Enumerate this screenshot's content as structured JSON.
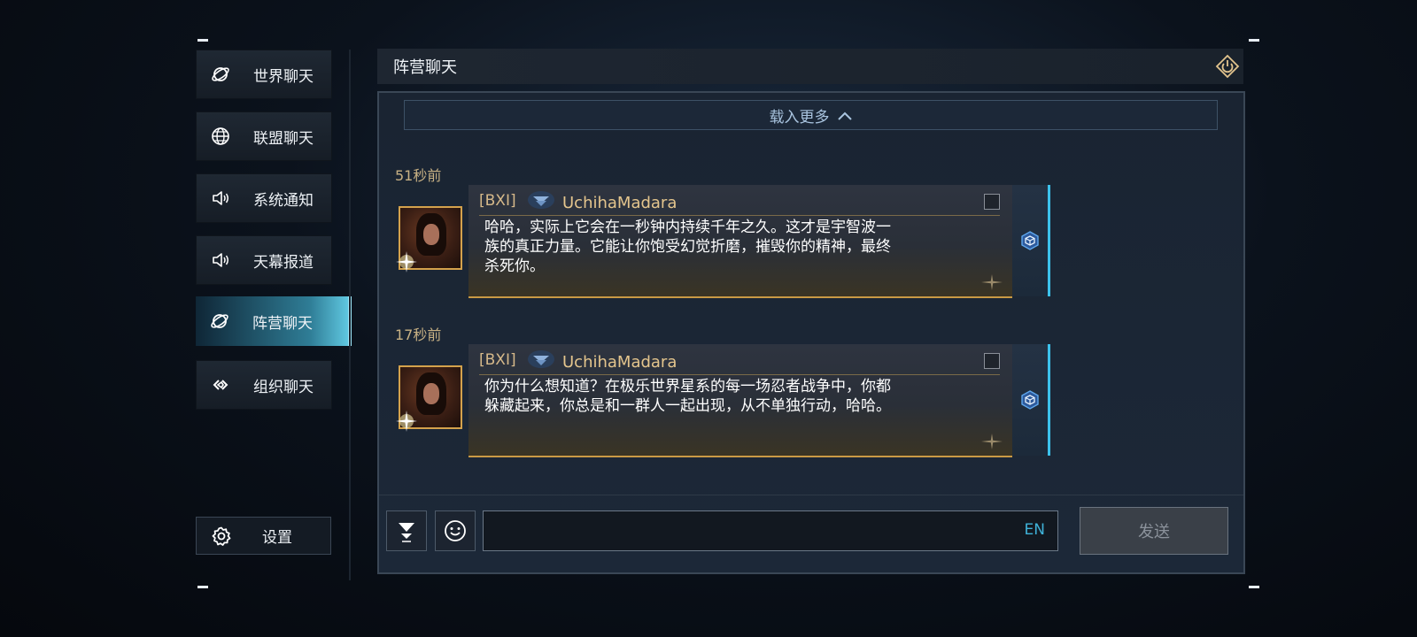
{
  "sidebar": {
    "items": [
      {
        "label": "世界聊天",
        "icon": "planet-icon"
      },
      {
        "label": "联盟聊天",
        "icon": "globe-icon"
      },
      {
        "label": "系统通知",
        "icon": "speaker-icon"
      },
      {
        "label": "天幕报道",
        "icon": "speaker-icon"
      },
      {
        "label": "阵营聊天",
        "icon": "planet-icon",
        "active": true
      },
      {
        "label": "组织聊天",
        "icon": "link-icon"
      }
    ],
    "settings_label": "设置"
  },
  "header": {
    "title": "阵营聊天"
  },
  "chat": {
    "load_more": "载入更多",
    "messages": [
      {
        "time": "51秒前",
        "tag": "[BXI]",
        "sender": "UchihaMadara",
        "text": "哈哈，实际上它会在一秒钟内持续千年之久。这才是宇智波一\n族的真正力量。它能让你饱受幻觉折磨，摧毁你的精神，最终\n杀死你。"
      },
      {
        "time": "17秒前",
        "tag": "[BXI]",
        "sender": "UchihaMadara",
        "text": "你为什么想知道？在极乐世界星系的每一场忍者战争中，你都\n躲藏起来，你总是和一群人一起出现，从不单独行动，哈哈。"
      }
    ]
  },
  "input": {
    "value": "",
    "lang": "EN",
    "send_label": "发送"
  },
  "colors": {
    "accent_cyan": "#3cc2ec",
    "gold": "#d4a24c"
  }
}
